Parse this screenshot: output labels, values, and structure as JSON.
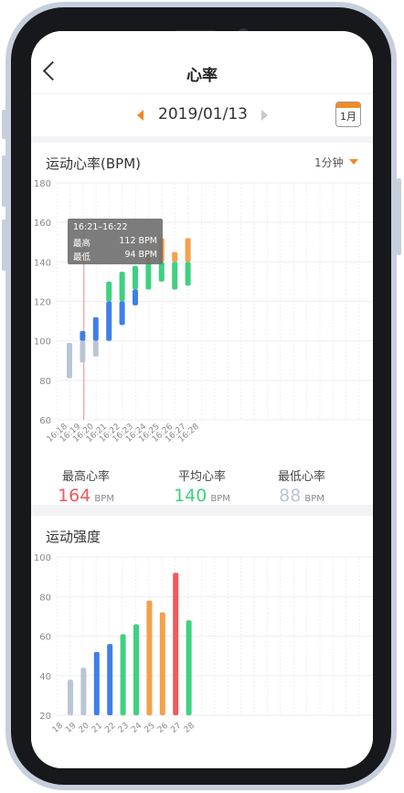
{
  "header": {
    "title": "心率"
  },
  "date_bar": {
    "date": "2019/01/13",
    "calendar_label": "1月"
  },
  "heart_rate_card": {
    "title": "运动心率(BPM)",
    "interval": "1分钟",
    "tooltip": {
      "range": "16:21–16:22",
      "max_label": "最高",
      "max_value": "112 BPM",
      "min_label": "最低",
      "min_value": "94 BPM"
    },
    "summary": [
      {
        "label": "最高心率",
        "value": "164",
        "unit": "BPM",
        "color": "#f05a5a"
      },
      {
        "label": "平均心率",
        "value": "140",
        "unit": "BPM",
        "color": "#3ed17f"
      },
      {
        "label": "最低心率",
        "value": "88",
        "unit": "BPM",
        "color": "#b9c6d6"
      }
    ]
  },
  "intensity_card": {
    "title": "运动强度"
  },
  "colors": {
    "gray": "#b9c6d6",
    "blue": "#3f7fe8",
    "green": "#3ed17f",
    "orange": "#f5a04b",
    "red": "#f05a5a"
  },
  "chart_data": [
    {
      "type": "bar",
      "title": "运动心率(BPM)",
      "ylim": [
        60,
        180
      ],
      "yticks": [
        60,
        80,
        100,
        120,
        140,
        160,
        180
      ],
      "categories": [
        "16:18",
        "16:19",
        "16:20",
        "16:21",
        "16:22",
        "16:23",
        "16:24",
        "16:25",
        "16:26",
        "16:27",
        "16:28"
      ],
      "ranges": [
        {
          "low": 81,
          "high": 99,
          "segments": [
            {
              "from": 81,
              "to": 99,
              "color": "gray"
            }
          ]
        },
        {
          "low": 89,
          "high": 105,
          "segments": [
            {
              "from": 89,
              "to": 100,
              "color": "gray"
            },
            {
              "from": 100,
              "to": 105,
              "color": "blue"
            }
          ]
        },
        {
          "low": 92,
          "high": 112,
          "segments": [
            {
              "from": 92,
              "to": 100,
              "color": "gray"
            },
            {
              "from": 100,
              "to": 112,
              "color": "blue"
            }
          ]
        },
        {
          "low": 100,
          "high": 130,
          "segments": [
            {
              "from": 100,
              "to": 120,
              "color": "blue"
            },
            {
              "from": 120,
              "to": 130,
              "color": "green"
            }
          ]
        },
        {
          "low": 108,
          "high": 135,
          "segments": [
            {
              "from": 108,
              "to": 120,
              "color": "blue"
            },
            {
              "from": 120,
              "to": 135,
              "color": "green"
            }
          ]
        },
        {
          "low": 118,
          "high": 138,
          "segments": [
            {
              "from": 118,
              "to": 126,
              "color": "blue"
            },
            {
              "from": 126,
              "to": 138,
              "color": "green"
            }
          ]
        },
        {
          "low": 126,
          "high": 145,
          "segments": [
            {
              "from": 126,
              "to": 140,
              "color": "green"
            },
            {
              "from": 140,
              "to": 145,
              "color": "orange"
            }
          ]
        },
        {
          "low": 130,
          "high": 152,
          "segments": [
            {
              "from": 130,
              "to": 140,
              "color": "green"
            },
            {
              "from": 140,
              "to": 152,
              "color": "orange"
            }
          ]
        },
        {
          "low": 126,
          "high": 145,
          "segments": [
            {
              "from": 126,
              "to": 140,
              "color": "green"
            },
            {
              "from": 140,
              "to": 145,
              "color": "orange"
            }
          ]
        },
        {
          "low": 128,
          "high": 152,
          "segments": [
            {
              "from": 128,
              "to": 140,
              "color": "green"
            },
            {
              "from": 140,
              "to": 152,
              "color": "orange"
            }
          ]
        },
        null
      ],
      "highlight_index": 2
    },
    {
      "type": "bar",
      "title": "运动强度",
      "ylim": [
        20,
        100
      ],
      "yticks": [
        20,
        40,
        60,
        80,
        100
      ],
      "categories": [
        "18",
        "19",
        "20",
        "21",
        "22",
        "23",
        "24",
        "25",
        "26",
        "27",
        "28"
      ],
      "values": [
        38,
        44,
        52,
        56,
        61,
        66,
        78,
        72,
        92,
        68,
        null
      ],
      "bar_colors": [
        "gray",
        "gray",
        "blue",
        "blue",
        "green",
        "green",
        "orange",
        "orange",
        "red",
        "green",
        "gray"
      ]
    }
  ]
}
